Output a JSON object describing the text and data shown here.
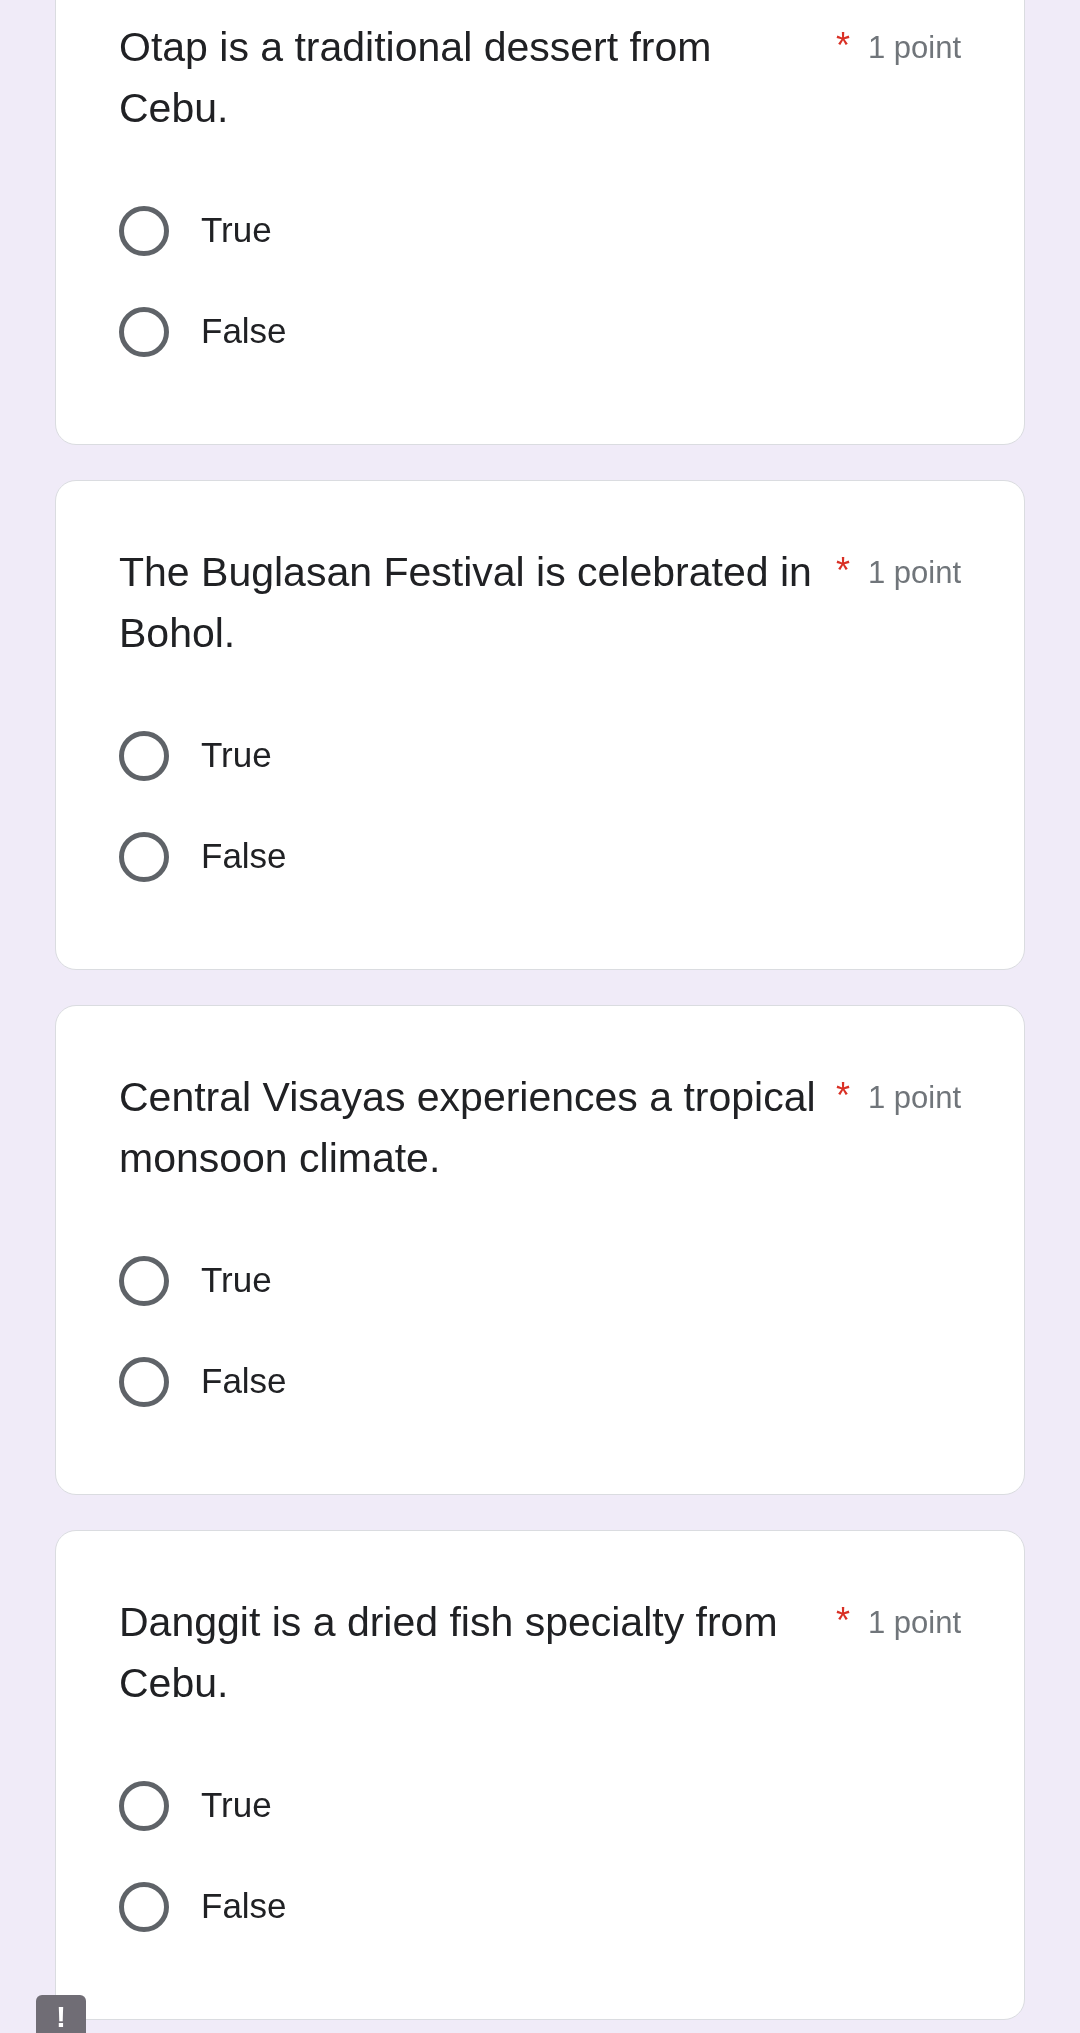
{
  "questions": [
    {
      "text": "Otap is a traditional dessert from Cebu.",
      "required_mark": "*",
      "points": "1 point",
      "options": [
        {
          "label": "True",
          "selected": false
        },
        {
          "label": "False",
          "selected": false
        }
      ]
    },
    {
      "text": "The Buglasan Festival is celebrated in Bohol.",
      "required_mark": "*",
      "points": "1 point",
      "options": [
        {
          "label": "True",
          "selected": false
        },
        {
          "label": "False",
          "selected": false
        }
      ]
    },
    {
      "text": "Central Visayas experiences a tropical monsoon climate.",
      "required_mark": "*",
      "points": "1 point",
      "options": [
        {
          "label": "True",
          "selected": false
        },
        {
          "label": "False",
          "selected": false
        }
      ]
    },
    {
      "text": "Danggit is a dried fish specialty from Cebu.",
      "required_mark": "*",
      "points": "1 point",
      "options": [
        {
          "label": "True",
          "selected": false
        },
        {
          "label": "False",
          "selected": false
        }
      ]
    }
  ],
  "alert_button": {
    "label": "!"
  }
}
